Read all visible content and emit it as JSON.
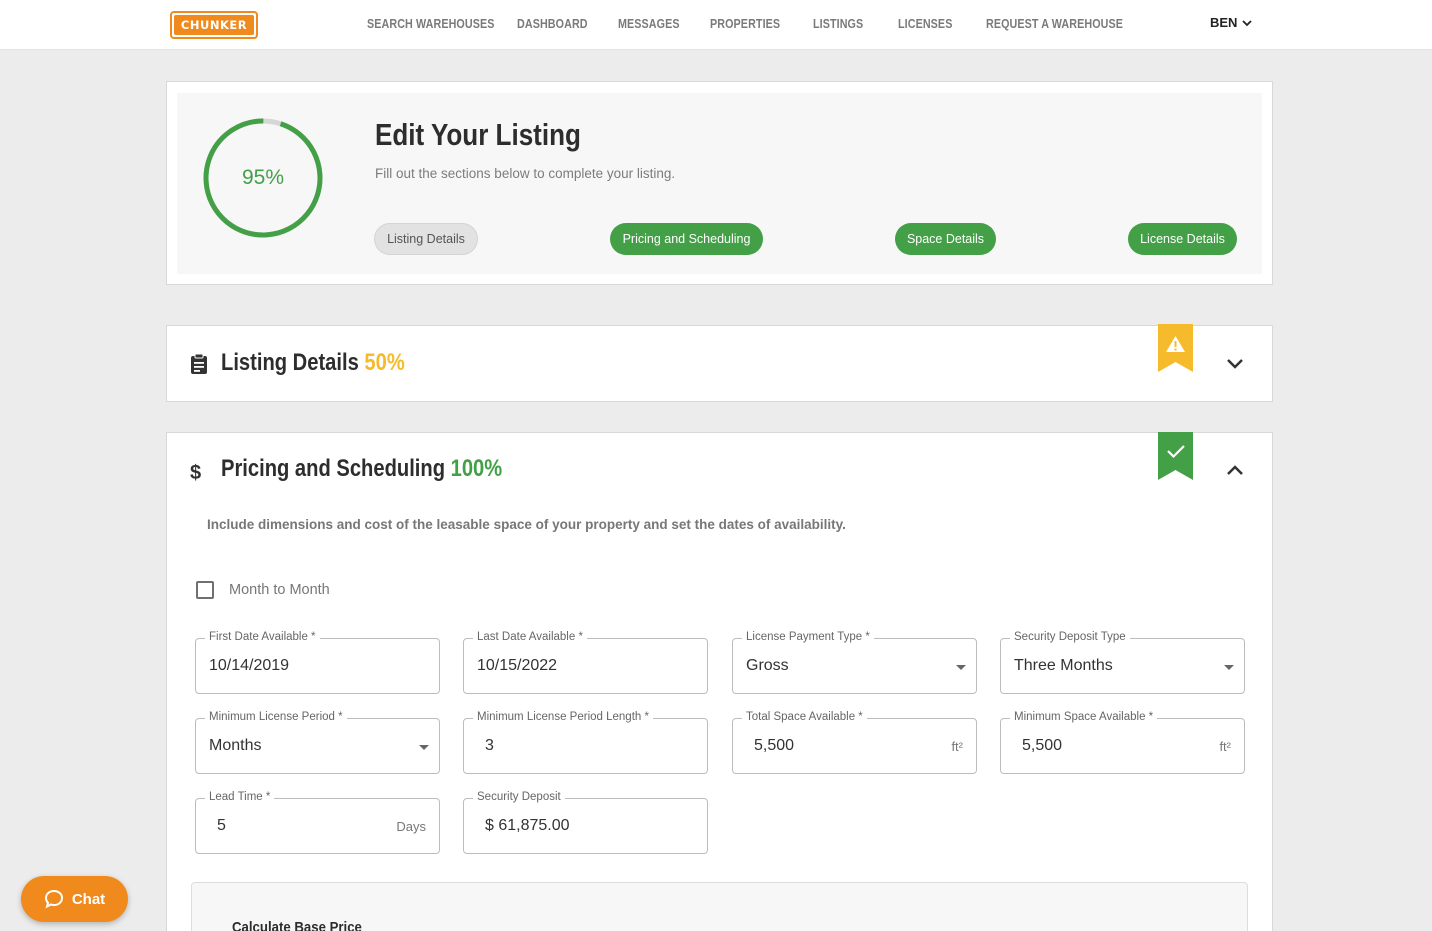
{
  "nav": {
    "logo_text": "CHUNKER",
    "links": [
      {
        "label": "SEARCH WAREHOUSES"
      },
      {
        "label": "DASHBOARD"
      },
      {
        "label": "MESSAGES"
      },
      {
        "label": "PROPERTIES"
      },
      {
        "label": "LISTINGS"
      },
      {
        "label": "LICENSES"
      },
      {
        "label": "REQUEST A WAREHOUSE"
      }
    ],
    "user": "BEN"
  },
  "progress": {
    "percent_label": "95%",
    "percent_value": 95,
    "title": "Edit Your Listing",
    "subtitle": "Fill out the sections below to complete your listing.",
    "steps": [
      {
        "label": "Listing Details",
        "status": "incomplete"
      },
      {
        "label": "Pricing and Scheduling",
        "status": "complete"
      },
      {
        "label": "Space Details",
        "status": "complete"
      },
      {
        "label": "License Details",
        "status": "complete"
      }
    ]
  },
  "sections": {
    "listing_details": {
      "title": "Listing Details",
      "percent": "50%",
      "icon": "clipboard-icon",
      "status_icon": "warning-icon"
    },
    "pricing": {
      "title": "Pricing and Scheduling",
      "percent": "100%",
      "icon": "dollar-icon",
      "status_icon": "check-icon",
      "description": "Include dimensions and cost of the leasable space of your property and set the dates of availability.",
      "month_to_month_label": "Month to Month",
      "fields": {
        "first_date": {
          "label": "First Date Available *",
          "value": "10/14/2019"
        },
        "last_date": {
          "label": "Last Date Available *",
          "value": "10/15/2022"
        },
        "payment_type": {
          "label": "License Payment Type *",
          "value": "Gross"
        },
        "deposit_type": {
          "label": "Security Deposit Type",
          "value": "Three Months"
        },
        "min_period": {
          "label": "Minimum License Period *",
          "value": "Months"
        },
        "min_period_length": {
          "label": "Minimum License Period Length *",
          "value": "3"
        },
        "total_space": {
          "label": "Total Space Available *",
          "value": "5,500",
          "unit": "ft²"
        },
        "min_space": {
          "label": "Minimum Space Available *",
          "value": "5,500",
          "unit": "ft²"
        },
        "lead_time": {
          "label": "Lead Time *",
          "value": "5",
          "unit": "Days"
        },
        "security_deposit": {
          "label": "Security Deposit",
          "value": "$ 61,875.00"
        }
      },
      "calc_title": "Calculate Base Price"
    }
  },
  "chat": {
    "label": "Chat"
  },
  "colors": {
    "brand_orange": "#f08a1c",
    "green": "#43a047",
    "yellow": "#f5bb2c"
  }
}
